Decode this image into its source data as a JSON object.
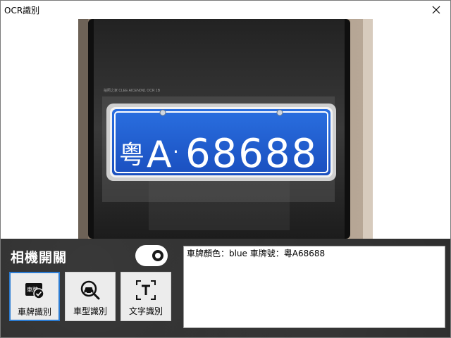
{
  "window": {
    "title": "OCR識別"
  },
  "preview": {
    "plate_province": "粤",
    "plate_letter": "A",
    "plate_dot": "·",
    "plate_number": "68688",
    "phone_overlay_text": "拍照之家 CLEE AICEN0N1 OCR 1B"
  },
  "panel": {
    "toggle_label": "相機開關",
    "toggle_state": "on",
    "buttons": [
      {
        "label": "車牌識別",
        "icon_text": "車牌",
        "icon": "plate-check-icon",
        "active": true
      },
      {
        "label": "車型識別",
        "icon": "car-search-icon",
        "active": false
      },
      {
        "label": "文字識別",
        "icon": "text-scan-icon",
        "active": false
      }
    ],
    "result": "車牌顏色：blue 車牌號：粵A68688"
  },
  "colors": {
    "plate_blue": "#1f5fd0",
    "panel_bg": "#2e2e2e",
    "active_border": "#2b7cd3"
  }
}
